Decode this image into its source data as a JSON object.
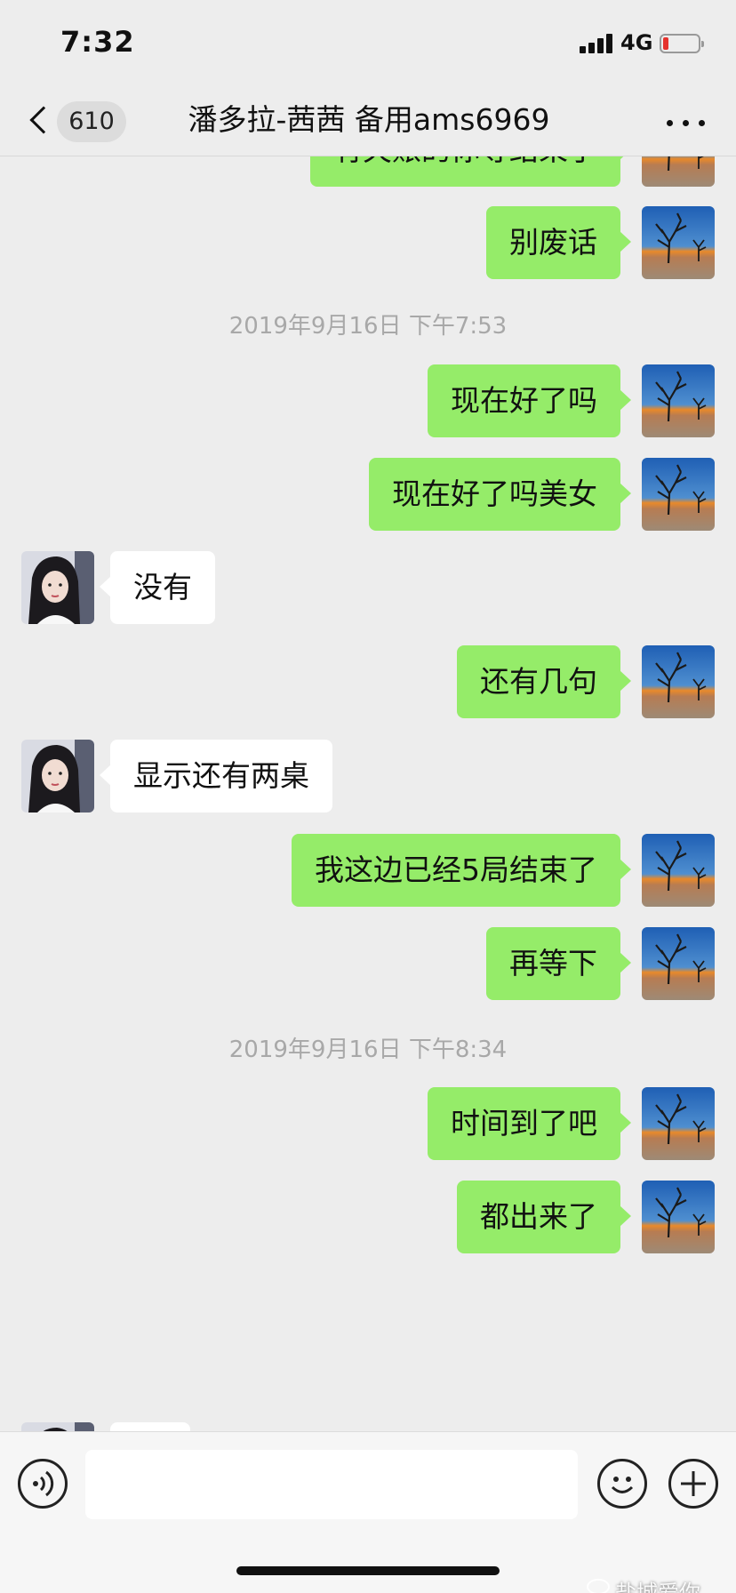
{
  "status_bar": {
    "time": "7:32",
    "network": "4G"
  },
  "nav": {
    "unread_count": "610",
    "title": "潘多拉-茜茜 备用ams6969"
  },
  "messages": [
    {
      "type": "bubble",
      "sender": "me",
      "text": "有欠账的你等结束了"
    },
    {
      "type": "bubble",
      "sender": "me",
      "text": "别废话"
    },
    {
      "type": "timestamp",
      "text": "2019年9月16日 下午7:53"
    },
    {
      "type": "bubble",
      "sender": "me",
      "text": "现在好了吗"
    },
    {
      "type": "bubble",
      "sender": "me",
      "text": "现在好了吗美女"
    },
    {
      "type": "bubble",
      "sender": "other",
      "text": "没有"
    },
    {
      "type": "bubble",
      "sender": "me",
      "text": "还有几句"
    },
    {
      "type": "bubble",
      "sender": "other",
      "text": "显示还有两桌"
    },
    {
      "type": "bubble",
      "sender": "me",
      "text": "我这边已经5局结束了"
    },
    {
      "type": "bubble",
      "sender": "me",
      "text": "再等下"
    },
    {
      "type": "timestamp",
      "text": "2019年9月16日 下午8:34"
    },
    {
      "type": "bubble",
      "sender": "me",
      "text": "时间到了吧"
    },
    {
      "type": "bubble",
      "sender": "me",
      "text": "都出来了"
    },
    {
      "type": "bubble",
      "sender": "other",
      "text": ""
    }
  ],
  "input": {
    "value": "",
    "placeholder": ""
  },
  "watermark": "盐城爱你",
  "colors": {
    "background": "#ededed",
    "my_bubble": "#95ec69",
    "other_bubble": "#ffffff",
    "timestamp": "#a8a8a8"
  },
  "icons": {
    "back": "chevron-left-icon",
    "more": "more-dots-icon",
    "voice": "voice-icon",
    "emoji": "emoji-icon",
    "plus": "plus-icon"
  }
}
